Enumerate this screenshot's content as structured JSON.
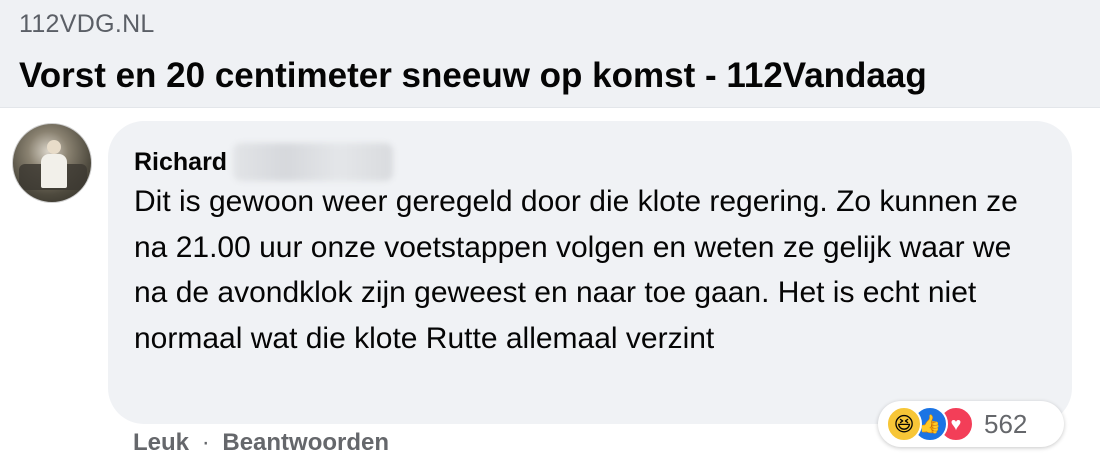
{
  "link_preview": {
    "domain": "112VDG.NL",
    "title": "Vorst en 20 centimeter sneeuw op komst - 112Vandaag"
  },
  "comment": {
    "author": "Richard",
    "text": "Dit is gewoon weer geregeld door die klote regering. Zo kunnen ze na 21.00 uur onze voetstappen volgen en weten ze gelijk waar we na de avondklok zijn geweest en naar toe gaan. Het is echt niet normaal wat die klote Rutte allemaal verzint",
    "reactions": {
      "icons": [
        "haha-icon",
        "like-icon",
        "love-icon"
      ],
      "count": "562"
    },
    "actions": {
      "like": "Leuk",
      "separator": "·",
      "reply": "Beantwoorden"
    }
  },
  "colors": {
    "preview_bg": "#eff1f4",
    "bubble_bg": "#f0f2f5",
    "like_blue": "#1b74e4",
    "love_red": "#f33e58",
    "haha_yellow": "#f7c637",
    "muted_text": "#65676b"
  }
}
